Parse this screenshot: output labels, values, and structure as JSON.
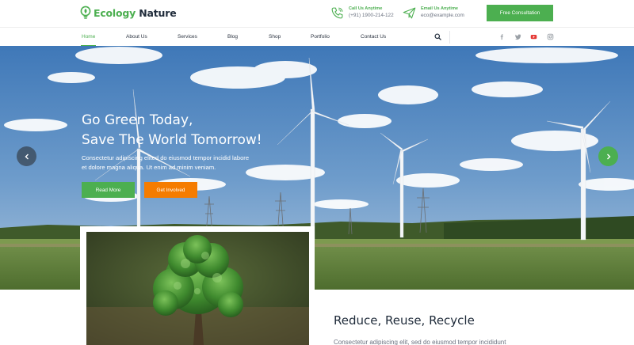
{
  "brand": {
    "word1": "Ecology",
    "word2": "Nature",
    "green": "#4caf50",
    "dark": "#1f2b3a"
  },
  "contacts": [
    {
      "icon": "phone-icon",
      "title": "Call Us Anytime",
      "value": "(+91) 1900-214-122"
    },
    {
      "icon": "paper-plane-icon",
      "title": "Email Us Anytime",
      "value": "eco@example.com"
    }
  ],
  "header_button": "Free Consultation",
  "nav": {
    "items": [
      "Home",
      "About Us",
      "Services",
      "Blog",
      "Shop",
      "Portfolio",
      "Contact Us"
    ],
    "active": "Home",
    "social": [
      "facebook-icon",
      "twitter-icon",
      "youtube-icon",
      "instagram-icon"
    ]
  },
  "hero": {
    "title_line1": "Go Green Today,",
    "title_line2": "Save The World Tomorrow!",
    "desc_line1": "Consectetur adipiscing elited do eiusmod tempor incidid labore",
    "desc_line2": "et dolore magna aliqua. Ut enim ad minim veniam.",
    "primary_button": "Read More",
    "secondary_button": "Get Involved",
    "primary_color": "#4caf50",
    "secondary_color": "#f57c00"
  },
  "section": {
    "title": "Reduce, Reuse, Recycle",
    "text": "Consectetur adipiscing elit, sed do eiusmod tempor incididunt"
  }
}
